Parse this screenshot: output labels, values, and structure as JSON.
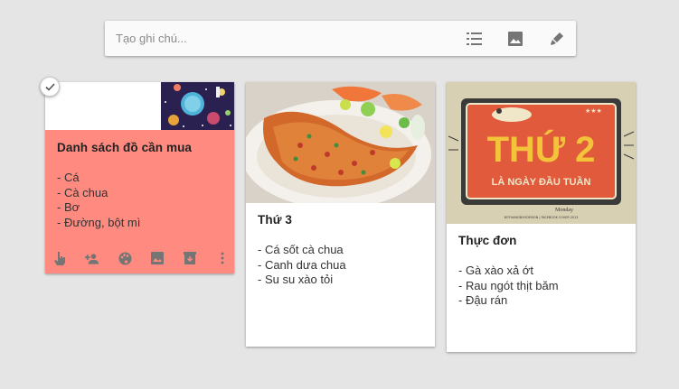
{
  "note_bar": {
    "placeholder": "Tạo ghi chú...",
    "icons": [
      "list-icon",
      "image-icon",
      "brush-icon"
    ]
  },
  "cards": [
    {
      "title": "Danh sách đồ cần mua",
      "items": [
        "- Cá",
        "- Cà chua",
        "- Bơ",
        "- Đường, bột mì"
      ],
      "color": "#ff8a80",
      "toolbar_icons": [
        "remind-hand-icon",
        "collaborator-icon",
        "palette-icon",
        "image-icon",
        "archive-icon",
        "more-vert-icon"
      ]
    },
    {
      "title": "Thứ 3",
      "items": [
        "- Cá sốt cà chua",
        "- Canh dưa chua",
        "- Su su xào tỏi"
      ],
      "color": "#ffffff"
    },
    {
      "title": "Thực đơn",
      "items": [
        "- Gà xào xả ớt",
        "- Rau ngót thịt băm",
        "- Đậu rán"
      ],
      "color": "#ffffff",
      "poster": {
        "headline": "THỨ 2",
        "subline": "LÀ NGÀY ĐẦU TUẦN",
        "caption": "Monday",
        "credit": "BOTHANGBOODESIGN | FACEBOOK COVER 2013",
        "stars": "★★★"
      }
    }
  ]
}
